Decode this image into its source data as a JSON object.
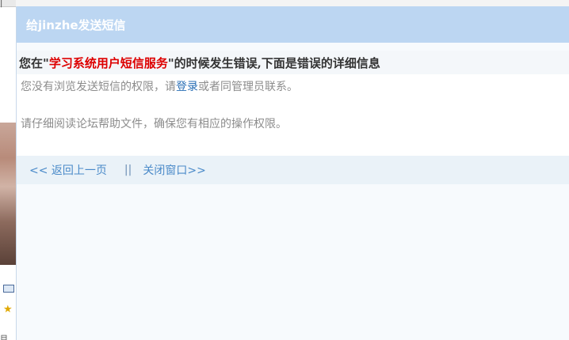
{
  "background": {
    "top_text": "|",
    "star_glyph": "★",
    "bottom_text": "目"
  },
  "dialog": {
    "title": "给jinzhe发送短信",
    "error_heading": {
      "prefix": "您在\"",
      "service_name": "学习系统用户短信服务",
      "suffix": "\"的时候发生错误,下面是错误的详细信息"
    },
    "message": {
      "line1_prefix": "您没有浏览发送短信的权限，请",
      "login_link": "登录",
      "line1_suffix": "或者同管理员联系。",
      "line2": "请仔细阅读论坛帮助文件，确保您有相应的操作权限。"
    },
    "nav": {
      "back_label": "<< 返回上一页",
      "separator": "||",
      "close_label": "关闭窗口>>"
    }
  },
  "colors": {
    "titlebar": "#bcd6f2",
    "service_name": "#dd0000",
    "link": "#4a8ac9"
  }
}
